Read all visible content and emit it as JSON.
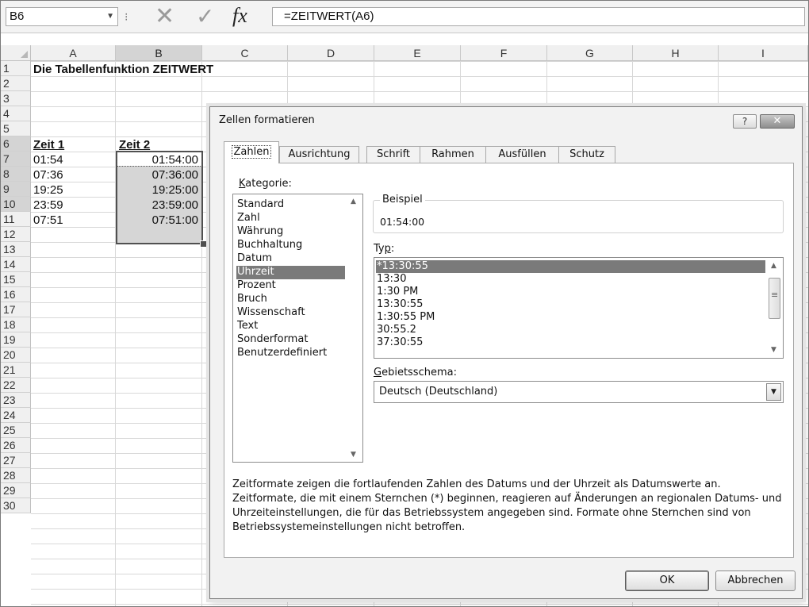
{
  "formula_bar": {
    "name_box": "B6",
    "formula": "=ZEITWERT(A6)"
  },
  "columns": [
    "A",
    "B",
    "C",
    "D",
    "E",
    "F",
    "G",
    "H",
    "I"
  ],
  "rows": [
    "1",
    "2",
    "3",
    "4",
    "5",
    "6",
    "7",
    "8",
    "9",
    "10",
    "11",
    "12",
    "13",
    "14",
    "15",
    "16",
    "17",
    "18",
    "19",
    "20",
    "21",
    "22",
    "23",
    "24",
    "25",
    "26",
    "27",
    "28",
    "29",
    "30"
  ],
  "sheet": {
    "title": "Die Tabellenfunktion ZEITWERT",
    "header_a": "Zeit 1",
    "header_b": "Zeit 2",
    "col_a": [
      "01:54",
      "07:36",
      "19:25",
      "23:59",
      "07:51"
    ],
    "col_b": [
      "01:54:00",
      "07:36:00",
      "19:25:00",
      "23:59:00",
      "07:51:00"
    ]
  },
  "dialog": {
    "title": "Zellen formatieren",
    "help": "?",
    "tabs": [
      "Zahlen",
      "Ausrichtung",
      "Schrift",
      "Rahmen",
      "Ausfüllen",
      "Schutz"
    ],
    "kategorie_label_u": "K",
    "kategorie_label_rest": "ategorie:",
    "categories": [
      "Standard",
      "Zahl",
      "Währung",
      "Buchhaltung",
      "Datum",
      "Uhrzeit",
      "Prozent",
      "Bruch",
      "Wissenschaft",
      "Text",
      "Sonderformat",
      "Benutzerdefiniert"
    ],
    "selected_category": "Uhrzeit",
    "beispiel_label": "Beispiel",
    "beispiel_value": "01:54:00",
    "typ_label_pre": "Ty",
    "typ_label_u": "p",
    "typ_label_post": ":",
    "types": [
      "*13:30:55",
      "13:30",
      "1:30 PM",
      "13:30:55",
      "1:30:55 PM",
      "30:55.2",
      "37:30:55"
    ],
    "gebiet_label_u": "G",
    "gebiet_label_rest": "ebietsschema:",
    "gebiet_value": "Deutsch (Deutschland)",
    "description": "Zeitformate zeigen die fortlaufenden Zahlen des Datums und der Uhrzeit als Datumswerte an. Zeitformate, die mit einem Sternchen (*) beginnen, reagieren auf Änderungen an regionalen Datums- und Uhrzeiteinstellungen, die für das Betriebssystem angegeben sind. Formate ohne Sternchen sind von Betriebssystemeinstellungen nicht betroffen.",
    "ok_label": "OK",
    "cancel_label": "Abbrechen"
  }
}
